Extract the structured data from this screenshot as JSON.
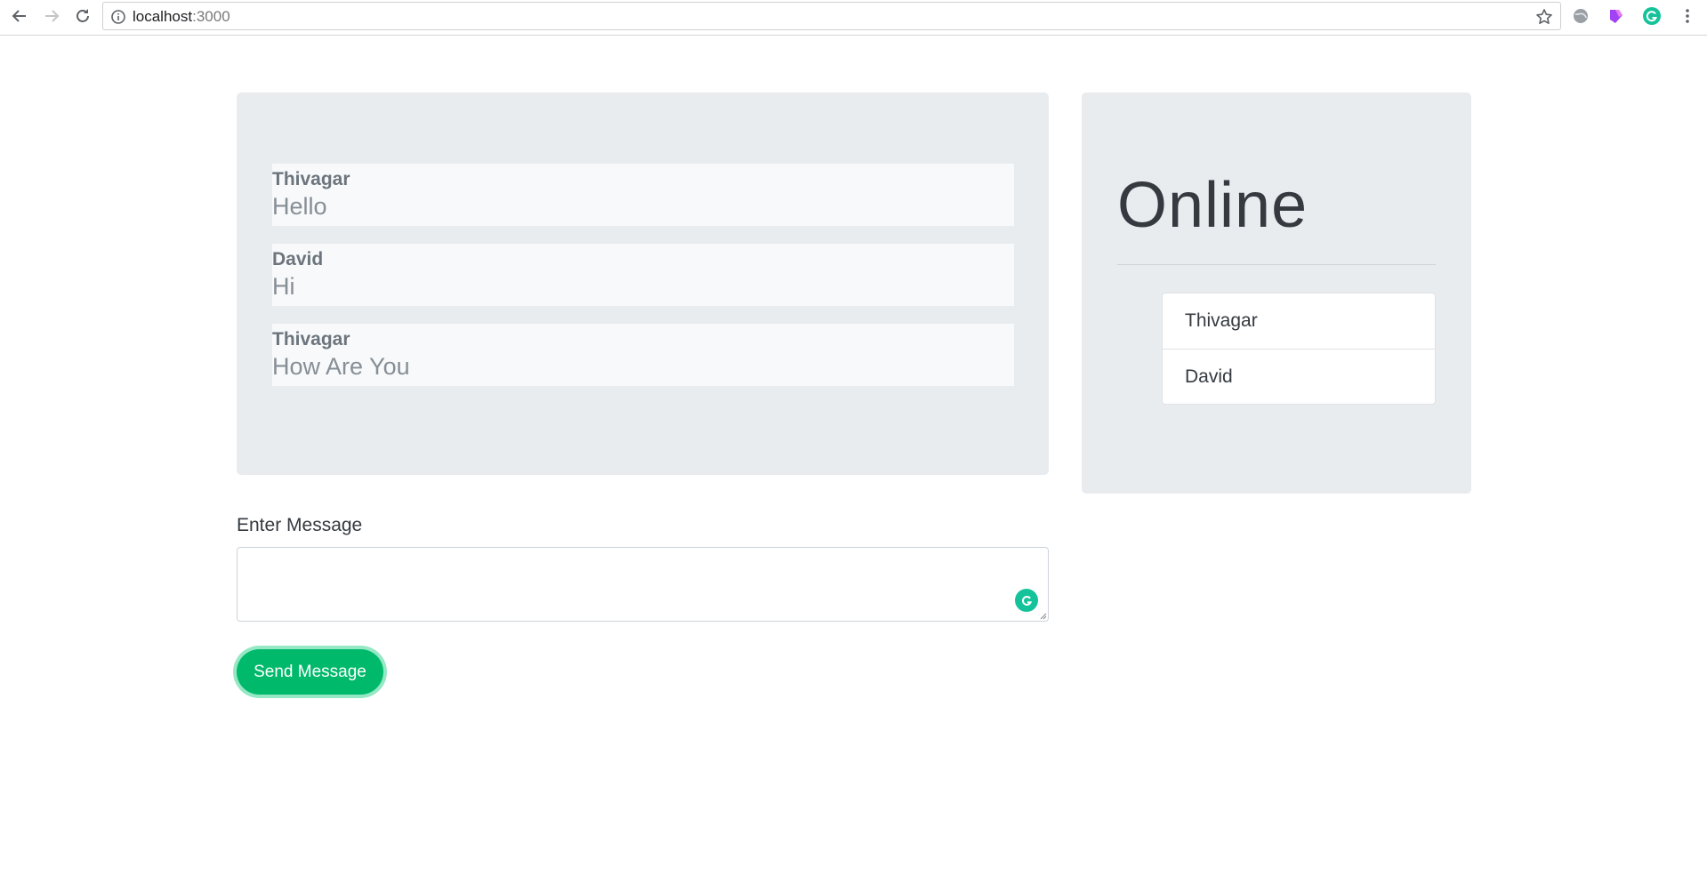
{
  "browser": {
    "url_host": "localhost",
    "url_port": ":3000"
  },
  "chat": {
    "messages": [
      {
        "author": "Thivagar",
        "text": "Hello"
      },
      {
        "author": "David",
        "text": "Hi"
      },
      {
        "author": "Thivagar",
        "text": "How Are You"
      }
    ]
  },
  "online": {
    "title": "Online",
    "users": [
      "Thivagar",
      "David"
    ]
  },
  "form": {
    "label": "Enter Message",
    "input_value": "",
    "send_label": "Send Message"
  },
  "colors": {
    "panel_bg": "#e9ecef",
    "message_bg": "#f8f9fa",
    "send_button": "#00b96b",
    "grammarly": "#15c39a"
  }
}
